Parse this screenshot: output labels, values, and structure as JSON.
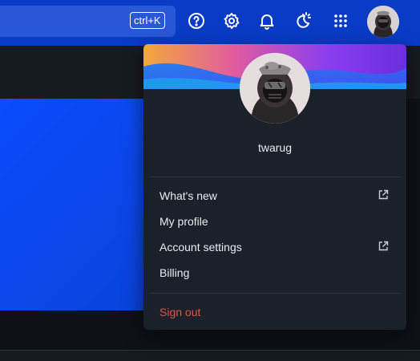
{
  "header": {
    "search_shortcut": "ctrl+K",
    "icons": [
      "help-icon",
      "gear-icon",
      "bell-icon",
      "theme-icon",
      "apps-grid-icon"
    ]
  },
  "profile": {
    "username": "twarug"
  },
  "menu": {
    "items": [
      {
        "label": "What's new",
        "external": true
      },
      {
        "label": "My profile",
        "external": false
      },
      {
        "label": "Account settings",
        "external": true
      },
      {
        "label": "Billing",
        "external": false
      }
    ],
    "sign_out": "Sign out"
  },
  "colors": {
    "topbar": "#0a3bc7",
    "dropdown_bg": "#1b2128",
    "sign_out": "#e5534b",
    "text": "#e6edf3"
  }
}
